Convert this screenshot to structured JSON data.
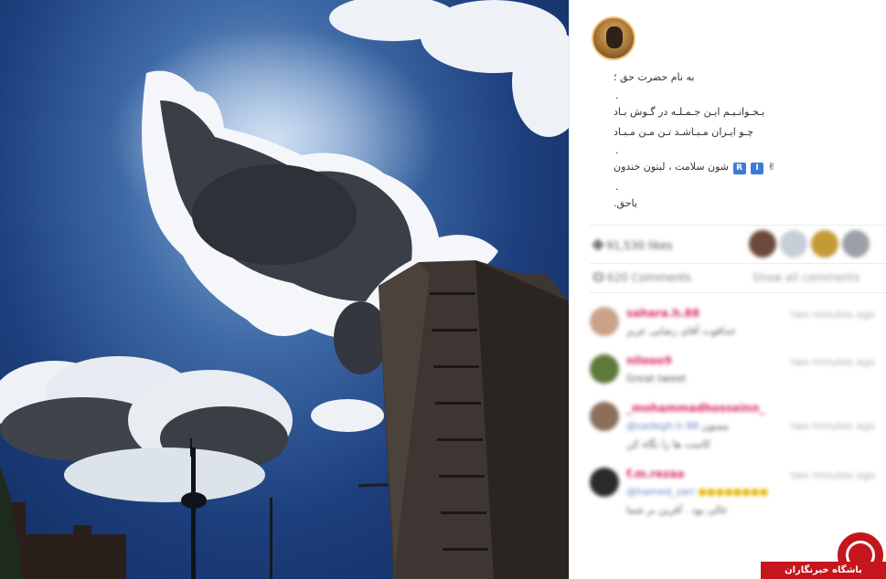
{
  "post": {
    "caption_lines": [
      "به نام حضرت حق ؛",
      "بـخـوانـیـم ایـن جـمـلـه در گـوش بـاد",
      "چـو ایـران مـبـاشـد تـن مـن مـبـاد",
      "شون سلامت ، لبتون خندون",
      "یاحق."
    ],
    "flag_letters": [
      "I",
      "R"
    ]
  },
  "stats": {
    "likes_text": "91,530 likes",
    "comments_text": "620 Comments",
    "show_all_label": "Show all comments"
  },
  "comments": [
    {
      "username": "sahara.h.88",
      "time": "two minutes ago",
      "text": "خداقوت آقای رضایی عزیز"
    },
    {
      "username": "nilooo9",
      "time": "two minutes ago",
      "text": "Great tweet"
    },
    {
      "username": "_mohammadhosseinn_",
      "time": "two minutes ago",
      "mention": "@sadegh.h.98",
      "text": "ممنون",
      "text2": "کامنت ها را نگاه کن"
    },
    {
      "username": "f.m.rezaa",
      "time": "two minutes ago",
      "mention": "@hamed_zari",
      "text2": "عالی بود . آفرین بر شما"
    }
  ],
  "watermark": {
    "label": "باشگاه خبرنگاران"
  },
  "colors": {
    "username": "#d72b60",
    "mention": "#6b82c9",
    "watermark": "#c4161c"
  }
}
